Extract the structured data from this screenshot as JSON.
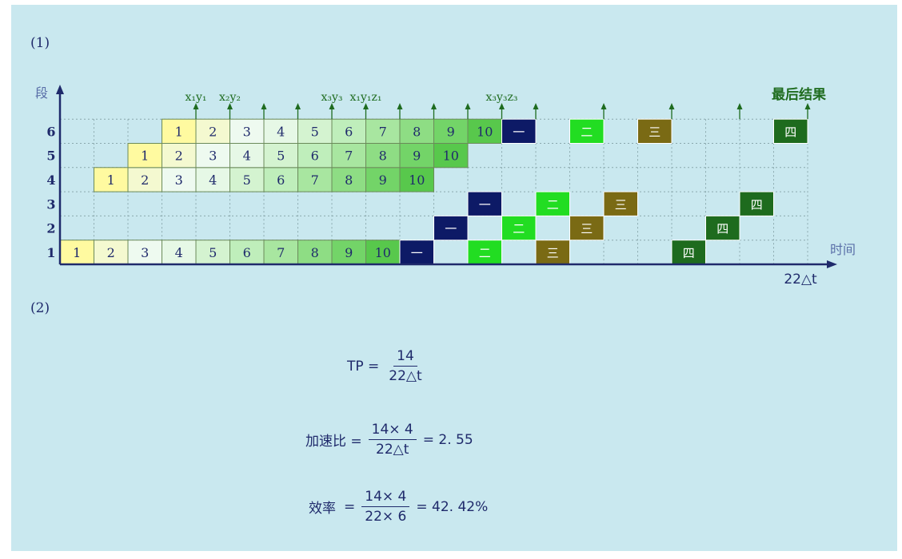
{
  "labels": {
    "part1": "(1)",
    "part2": "(2)"
  },
  "axes": {
    "y_label": "段",
    "x_label": "时间",
    "total_time": "22△t",
    "final_result": "最后结果"
  },
  "y_ticks": [
    "1",
    "2",
    "3",
    "4",
    "5",
    "6"
  ],
  "annotations": [
    {
      "text": "x₁y₁",
      "at_time": 4
    },
    {
      "text": "x₂y₂",
      "at_time": 5
    },
    {
      "text": "x₃y₃",
      "at_time": 8
    },
    {
      "text": "x₁y₁z₁",
      "at_time": 9
    },
    {
      "text": "x₃y₃z₃",
      "at_time": 13
    }
  ],
  "arrow_times": [
    4,
    5,
    6,
    7,
    8,
    9,
    10,
    11,
    12,
    13,
    14,
    16,
    18,
    20,
    22
  ],
  "cells": [
    {
      "seg": 1,
      "t": 0,
      "label": "1"
    },
    {
      "seg": 1,
      "t": 1,
      "label": "2"
    },
    {
      "seg": 1,
      "t": 2,
      "label": "3"
    },
    {
      "seg": 1,
      "t": 3,
      "label": "4"
    },
    {
      "seg": 1,
      "t": 4,
      "label": "5"
    },
    {
      "seg": 1,
      "t": 5,
      "label": "6"
    },
    {
      "seg": 1,
      "t": 6,
      "label": "7"
    },
    {
      "seg": 1,
      "t": 7,
      "label": "8"
    },
    {
      "seg": 1,
      "t": 8,
      "label": "9"
    },
    {
      "seg": 1,
      "t": 9,
      "label": "10"
    },
    {
      "seg": 1,
      "t": 10,
      "label": "一"
    },
    {
      "seg": 1,
      "t": 12,
      "label": "二"
    },
    {
      "seg": 1,
      "t": 14,
      "label": "三"
    },
    {
      "seg": 1,
      "t": 18,
      "label": "四"
    },
    {
      "seg": 2,
      "t": 11,
      "label": "一"
    },
    {
      "seg": 2,
      "t": 13,
      "label": "二"
    },
    {
      "seg": 2,
      "t": 15,
      "label": "三"
    },
    {
      "seg": 2,
      "t": 19,
      "label": "四"
    },
    {
      "seg": 3,
      "t": 12,
      "label": "一"
    },
    {
      "seg": 3,
      "t": 14,
      "label": "二"
    },
    {
      "seg": 3,
      "t": 16,
      "label": "三"
    },
    {
      "seg": 3,
      "t": 20,
      "label": "四"
    },
    {
      "seg": 4,
      "t": 1,
      "label": "1"
    },
    {
      "seg": 4,
      "t": 2,
      "label": "2"
    },
    {
      "seg": 4,
      "t": 3,
      "label": "3"
    },
    {
      "seg": 4,
      "t": 4,
      "label": "4"
    },
    {
      "seg": 4,
      "t": 5,
      "label": "5"
    },
    {
      "seg": 4,
      "t": 6,
      "label": "6"
    },
    {
      "seg": 4,
      "t": 7,
      "label": "7"
    },
    {
      "seg": 4,
      "t": 8,
      "label": "8"
    },
    {
      "seg": 4,
      "t": 9,
      "label": "9"
    },
    {
      "seg": 4,
      "t": 10,
      "label": "10"
    },
    {
      "seg": 5,
      "t": 2,
      "label": "1"
    },
    {
      "seg": 5,
      "t": 3,
      "label": "2"
    },
    {
      "seg": 5,
      "t": 4,
      "label": "3"
    },
    {
      "seg": 5,
      "t": 5,
      "label": "4"
    },
    {
      "seg": 5,
      "t": 6,
      "label": "5"
    },
    {
      "seg": 5,
      "t": 7,
      "label": "6"
    },
    {
      "seg": 5,
      "t": 8,
      "label": "7"
    },
    {
      "seg": 5,
      "t": 9,
      "label": "8"
    },
    {
      "seg": 5,
      "t": 10,
      "label": "9"
    },
    {
      "seg": 5,
      "t": 11,
      "label": "10"
    },
    {
      "seg": 6,
      "t": 3,
      "label": "1"
    },
    {
      "seg": 6,
      "t": 4,
      "label": "2"
    },
    {
      "seg": 6,
      "t": 5,
      "label": "3"
    },
    {
      "seg": 6,
      "t": 6,
      "label": "4"
    },
    {
      "seg": 6,
      "t": 7,
      "label": "5"
    },
    {
      "seg": 6,
      "t": 8,
      "label": "6"
    },
    {
      "seg": 6,
      "t": 9,
      "label": "7"
    },
    {
      "seg": 6,
      "t": 10,
      "label": "8"
    },
    {
      "seg": 6,
      "t": 11,
      "label": "9"
    },
    {
      "seg": 6,
      "t": 12,
      "label": "10"
    },
    {
      "seg": 6,
      "t": 13,
      "label": "一"
    },
    {
      "seg": 6,
      "t": 15,
      "label": "二"
    },
    {
      "seg": 6,
      "t": 17,
      "label": "三"
    },
    {
      "seg": 6,
      "t": 21,
      "label": "四"
    }
  ],
  "colors": {
    "background": "#c9e8ef",
    "axis": "#1f2a6b",
    "grid": "#8aa8ad",
    "annotation": "#1e6b1e",
    "op1": "#0d1a66",
    "op2": "#22dd22",
    "op3": "#7a6a14",
    "op4": "#1e6b1e",
    "num_ramp": [
      "#fffaa0",
      "#f4f9d0",
      "#eefaf0",
      "#e6f8e6",
      "#d4f3d0",
      "#bfeebb",
      "#a8e6a0",
      "#8edd84",
      "#73d468",
      "#58c84c"
    ]
  },
  "formulas": {
    "tp": {
      "lhs": "TP =",
      "num": "14",
      "den": "22△t"
    },
    "speedup": {
      "lhs": "加速比 =",
      "num": "14× 4",
      "den": "22△t",
      "result": "= 2. 55"
    },
    "efficiency": {
      "lhs": "效率",
      "eq": "=",
      "num": "14× 4",
      "den": "22× 6",
      "result": "= 42. 42%"
    }
  }
}
